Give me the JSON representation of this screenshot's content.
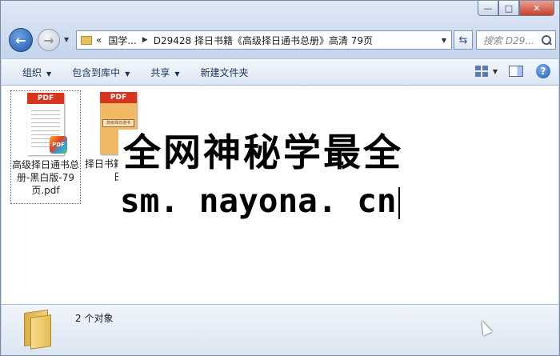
{
  "window": {
    "caption_buttons": {
      "minimize": "—",
      "maximize": "□",
      "close": "✕"
    }
  },
  "nav": {
    "back_icon": "←",
    "forward_icon": "→",
    "breadcrumb_prefix": "«",
    "breadcrumbs": [
      "国学...",
      "D29428 择日书籍《高级择日通书总册》高清 79页"
    ],
    "refresh_icon": "refresh-icon",
    "search_placeholder": "搜索 D29..."
  },
  "toolbar": {
    "organize": "组织",
    "include_in_library": "包含到库中",
    "share": "共享",
    "new_folder": "新建文件夹",
    "help": "?"
  },
  "files": [
    {
      "name": "高级择日通书总册-黑白版-79页.pdf",
      "type_label": "PDF",
      "badge": "PDF",
      "selected": true
    },
    {
      "name": "择日书籍高级择日",
      "type_label": "PDF",
      "cover_text": "高级择日通书",
      "selected": false
    }
  ],
  "overlay": {
    "line1": "全网神秘学最全",
    "line2": "sm. nayona. cn"
  },
  "status": {
    "item_count": "2 个对象"
  }
}
